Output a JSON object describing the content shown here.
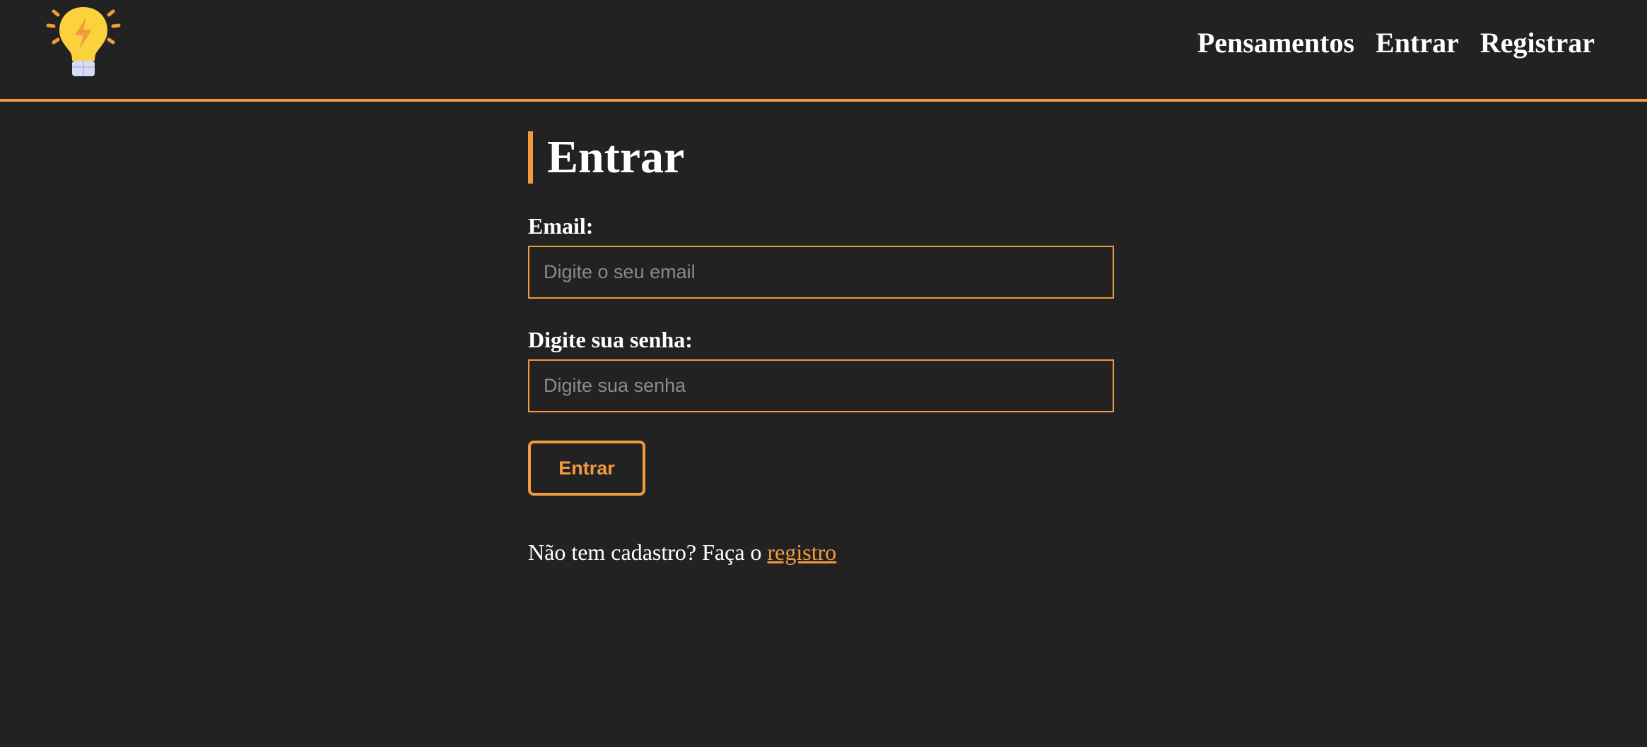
{
  "navbar": {
    "logo_icon": "lightbulb-icon",
    "links": [
      {
        "label": "Pensamentos"
      },
      {
        "label": "Entrar"
      },
      {
        "label": "Registrar"
      }
    ]
  },
  "main": {
    "title": "Entrar",
    "email": {
      "label": "Email:",
      "placeholder": "Digite o seu email",
      "value": ""
    },
    "password": {
      "label": "Digite sua senha:",
      "placeholder": "Digite sua senha",
      "value": ""
    },
    "submit_label": "Entrar",
    "register_prompt": "Não tem cadastro? Faça o ",
    "register_link": "registro"
  },
  "colors": {
    "background": "#222222",
    "accent": "#f19a3e",
    "text": "#ffffff",
    "placeholder": "#8a8a8a"
  }
}
